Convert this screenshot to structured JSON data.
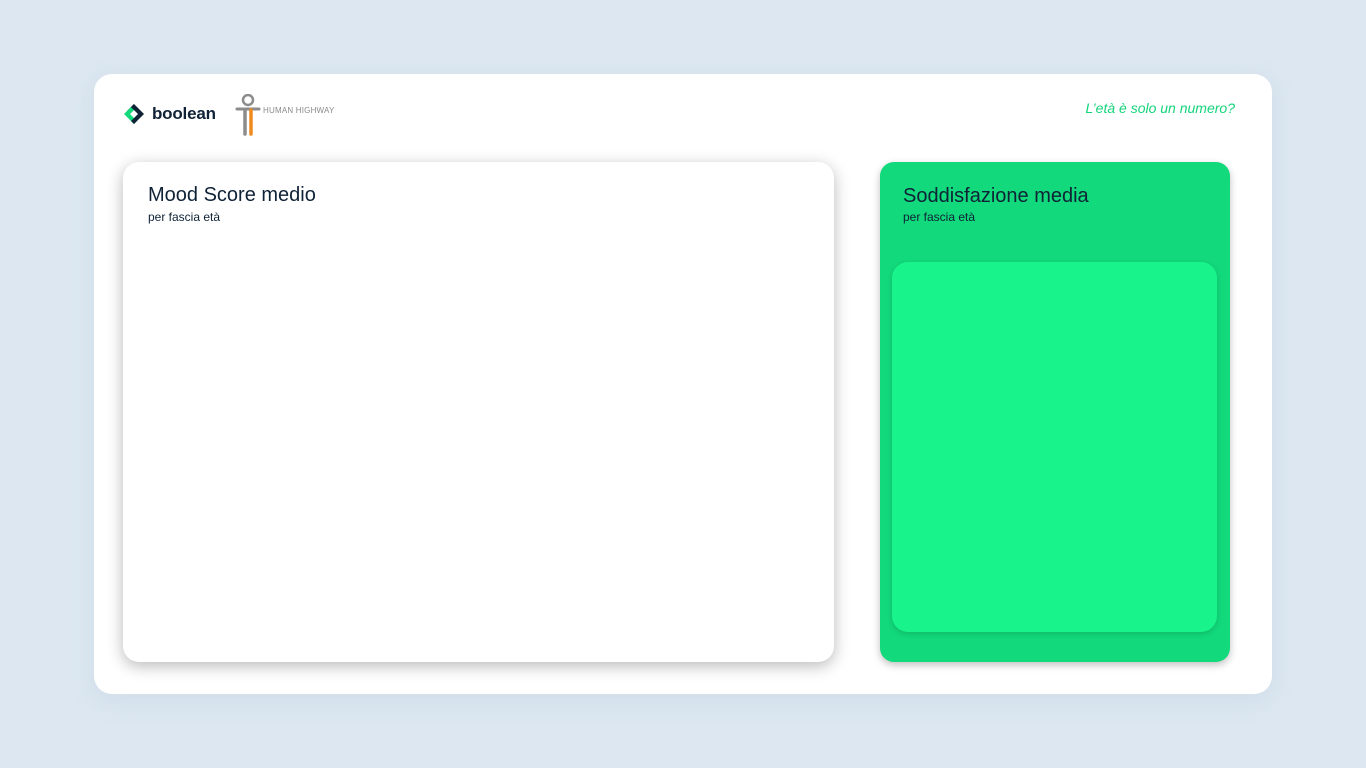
{
  "header": {
    "brand_name": "boolean",
    "brand_icon": "boolean-logo-icon",
    "partner_name": "HUMAN HIGHWAY",
    "partner_icon": "human-highway-logo-icon",
    "tagline": "L’età è solo un numero?"
  },
  "cards": {
    "mood": {
      "title": "Mood Score medio",
      "subtitle": "per fascia età"
    },
    "satisfaction": {
      "title": "Soddisfazione media",
      "subtitle": "per fascia età"
    }
  },
  "colors": {
    "background": "#dce7f1",
    "accent_green": "#12d97b",
    "panel_green": "#18f38c",
    "tagline_green": "#15d47c",
    "text_dark": "#0f2236"
  }
}
